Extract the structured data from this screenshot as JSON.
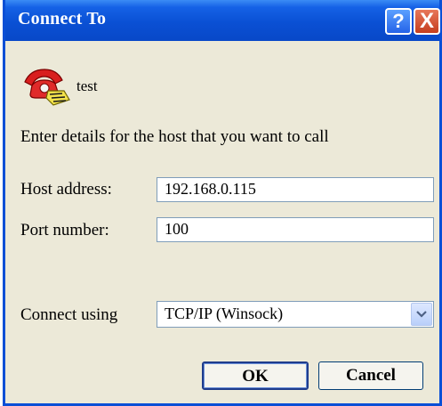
{
  "window": {
    "title": "Connect To",
    "help_label": "?",
    "close_label": "X"
  },
  "connection": {
    "name": "test",
    "icon": "telephone-icon"
  },
  "prompt": "Enter details for the host that you want to call",
  "form": {
    "host_label": "Host address:",
    "host_value": "192.168.0.115",
    "port_label": "Port number:",
    "port_value": "100",
    "connect_label": "Connect using",
    "connect_value": "TCP/IP (Winsock)"
  },
  "buttons": {
    "ok": "OK",
    "cancel": "Cancel"
  },
  "colors": {
    "titlebar": "#0A50D4",
    "dialog_bg": "#ECE9D8",
    "close_button": "#C53E1E"
  }
}
